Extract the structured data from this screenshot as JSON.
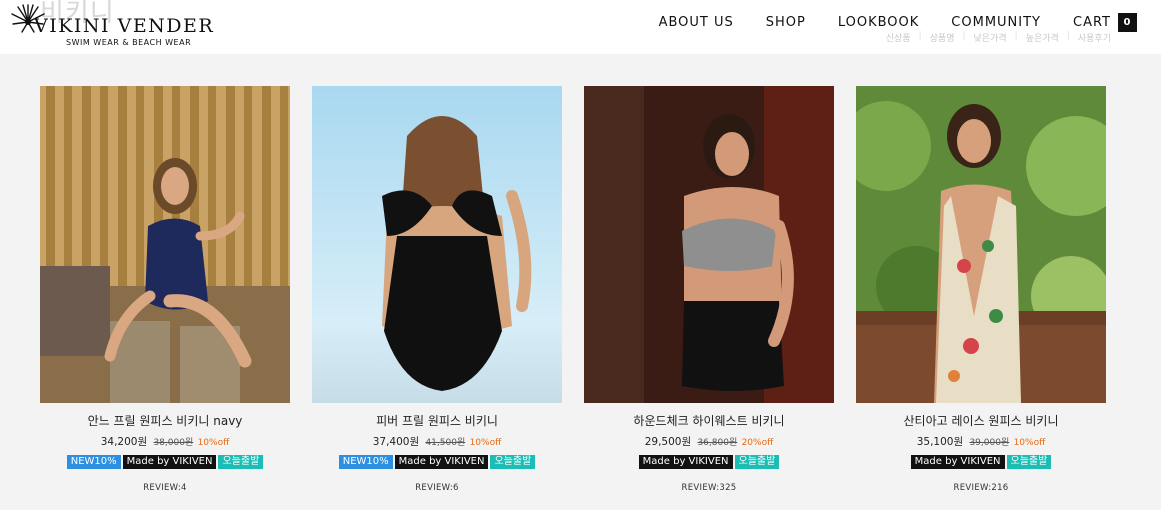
{
  "header": {
    "ghost_title": "비키니",
    "logo_name": "VIKINI VENDER",
    "logo_tagline": "SWIM WEAR & BEACH WEAR",
    "nav": [
      "ABOUT US",
      "SHOP",
      "LOOKBOOK",
      "COMMUNITY"
    ],
    "cart_label": "CART",
    "cart_count": "0"
  },
  "sort_options": [
    "신상품",
    "상품명",
    "낮은가격",
    "높은가격",
    "사용후기"
  ],
  "products": [
    {
      "name": "안느 프릴 원피스 비키니 navy",
      "price": "34,200원",
      "original_price": "38,000원",
      "discount": "10%off",
      "badges": [
        "NEW10%",
        "Made by VIKIVEN",
        "오늘출발"
      ],
      "review": "REVIEW:4"
    },
    {
      "name": "피버 프릴 원피스 비키니",
      "price": "37,400원",
      "original_price": "41,500원",
      "discount": "10%off",
      "badges": [
        "NEW10%",
        "Made by VIKIVEN",
        "오늘출발"
      ],
      "review": "REVIEW:6"
    },
    {
      "name": "하운드체크 하이웨스트 비키니",
      "price": "29,500원",
      "original_price": "36,800원",
      "discount": "20%off",
      "badges": [
        "Made by VIKIVEN",
        "오늘출발"
      ],
      "review": "REVIEW:325"
    },
    {
      "name": "산티아고 레이스 원피스 비키니",
      "price": "35,100원",
      "original_price": "39,000원",
      "discount": "10%off",
      "badges": [
        "Made by VIKIVEN",
        "오늘출발"
      ],
      "review": "REVIEW:216"
    }
  ],
  "colors": {
    "badge_new": "#2d8fe0",
    "badge_made": "#111111",
    "badge_today": "#1bbdb4",
    "discount": "#e86a10"
  }
}
